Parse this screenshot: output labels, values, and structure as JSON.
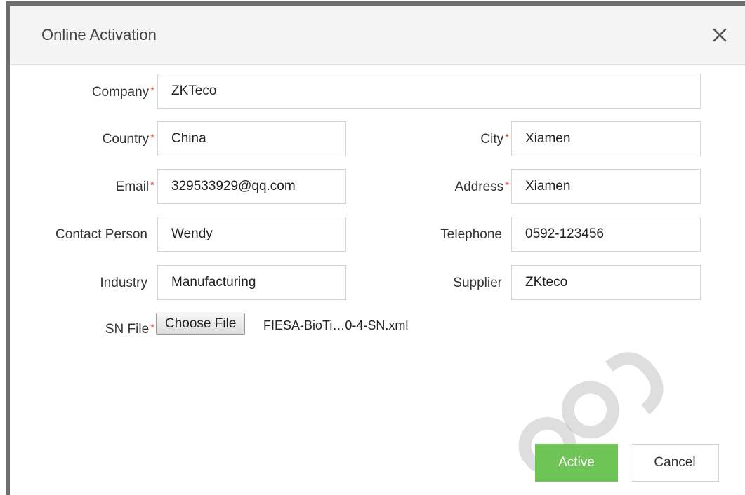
{
  "dialog": {
    "title": "Online Activation",
    "close_icon": "close-icon"
  },
  "form": {
    "company": {
      "label": "Company",
      "required": "*",
      "value": "ZKTeco"
    },
    "country": {
      "label": "Country",
      "required": "*",
      "value": "China"
    },
    "city": {
      "label": "City",
      "required": "*",
      "value": "Xiamen"
    },
    "email": {
      "label": "Email",
      "required": "*",
      "value": "329533929@qq.com"
    },
    "address": {
      "label": "Address",
      "required": "*",
      "value": "Xiamen"
    },
    "contact_person": {
      "label": "Contact Person",
      "value": "Wendy"
    },
    "telephone": {
      "label": "Telephone",
      "value": "0592-123456"
    },
    "industry": {
      "label": "Industry",
      "value": "Manufacturing"
    },
    "supplier": {
      "label": "Supplier",
      "value": "ZKteco"
    },
    "sn_file": {
      "label": "SN File",
      "required": "*",
      "button_label": "Choose File",
      "file_name": "FIESA-BioTi…0-4-SN.xml"
    }
  },
  "actions": {
    "active_label": "Active",
    "cancel_label": "Cancel"
  },
  "colors": {
    "required_asterisk": "#e0483e",
    "primary_button": "#6ec456",
    "header_background": "#f4f4f4"
  }
}
